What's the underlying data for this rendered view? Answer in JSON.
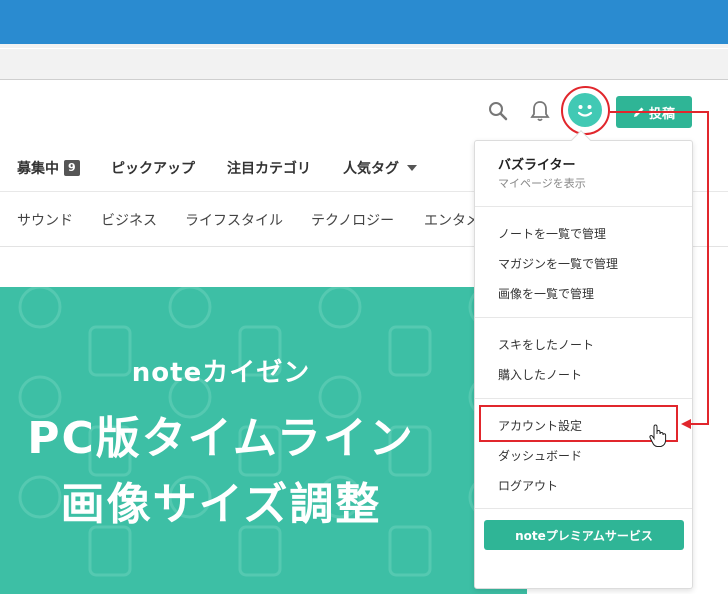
{
  "header": {
    "post_label": "投稿",
    "accent": "#2fb596",
    "avatar_color": "#41c9b4"
  },
  "nav_primary": [
    {
      "label": "募集中",
      "badge": "9"
    },
    {
      "label": "ピックアップ"
    },
    {
      "label": "注目カテゴリ"
    },
    {
      "label": "人気タグ"
    }
  ],
  "nav_secondary": [
    "サウンド",
    "ビジネス",
    "ライフスタイル",
    "テクノロジー",
    "エンタメ"
  ],
  "banner": {
    "subtitle": "noteカイゼン",
    "title_line1": "PC版タイムライン",
    "title_line2": "画像サイズ調整",
    "color": "#3dbfa5"
  },
  "menu": {
    "user_name": "バズライター",
    "mypage": "マイページを表示",
    "group1": [
      "ノートを一覧で管理",
      "マガジンを一覧で管理",
      "画像を一覧で管理"
    ],
    "group2": [
      "スキをしたノート",
      "購入したノート"
    ],
    "group3": [
      "アカウント設定",
      "ダッシュボード",
      "ログアウト"
    ],
    "premium": "noteプレミアムサービス"
  },
  "annotation_color": "#e1262c"
}
